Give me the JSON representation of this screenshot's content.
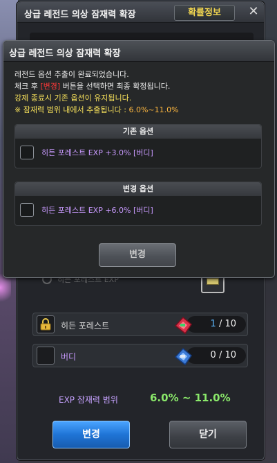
{
  "back_window": {
    "title": "상급 레전드 의상 잠재력 확장",
    "probability_button": "확률정보",
    "close_glyph": "✕",
    "option_row_text": "히든 포레스트 EXP",
    "slots": [
      {
        "label": "히든 포레스트",
        "current": "1",
        "total": "/ 10",
        "locked": true,
        "gem": "red-gem-icon"
      },
      {
        "label": "버디",
        "current": "0",
        "total": "/ 10",
        "locked": false,
        "gem": "blue-gem-icon"
      }
    ],
    "range_label": "EXP 잠재력 범위",
    "range_value": "6.0% ~ 11.0%",
    "change_button": "변경",
    "close_button": "닫기"
  },
  "dialog": {
    "title": "상급 레전드 의상 잠재력 확장",
    "line1": "레전드 옵션 추출이 완료되었습니다.",
    "line2_pre": "체크 후 ",
    "line2_red": "[변경]",
    "line2_post": " 버튼을 선택하면 최종 확정됩니다.",
    "line3": "강제 종료시 기존 옵션이 유지됩니다.",
    "line4_pre": "※ 잠재력 범위 내에서 추출됩니다 : ",
    "line4_value": "6.0%~11.0%",
    "existing_header": "기존 옵션",
    "existing_option": "히든 포레스트 EXP +3.0% [버디]",
    "changed_header": "변경 옵션",
    "changed_option": "히든 포레스트 EXP +6.0% [버디]",
    "change_button": "변경"
  },
  "colors": {
    "purple_text": "#c99aff",
    "yellow_text": "#f6e05a",
    "red_text": "#ff3838",
    "range_green": "#8ae86a",
    "blue_button": "#1f74d6"
  }
}
